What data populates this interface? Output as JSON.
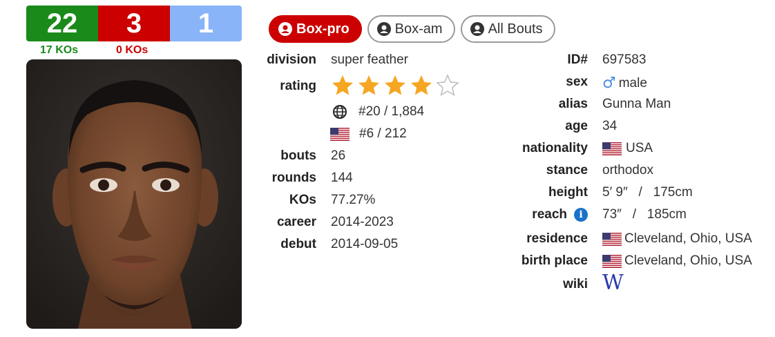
{
  "record": {
    "wins": "22",
    "losses": "3",
    "draws": "1",
    "win_kos": "17 KOs",
    "loss_kos": "0 KOs"
  },
  "colors": {
    "win": "#1a8a1a",
    "loss": "#cc0000",
    "draw": "#8ab4f8",
    "star": "#f5a623"
  },
  "tabs": [
    {
      "label": "Box-pro",
      "active": true,
      "icon": "user-circle-icon"
    },
    {
      "label": "Box-am",
      "active": false,
      "icon": "user-circle-icon"
    },
    {
      "label": "All Bouts",
      "active": false,
      "icon": "user-circle-icon"
    }
  ],
  "left": {
    "division_label": "division",
    "division": "super feather",
    "rating_label": "rating",
    "rating_stars": 4,
    "rating_max": 5,
    "world_rank": "#20 / 1,884",
    "us_rank": "#6 / 212",
    "bouts_label": "bouts",
    "bouts": "26",
    "rounds_label": "rounds",
    "rounds": "144",
    "kos_label": "KOs",
    "kos": "77.27%",
    "career_label": "career",
    "career": "2014-2023",
    "debut_label": "debut",
    "debut": "2014-09-05"
  },
  "right": {
    "id_label": "ID#",
    "id": "697583",
    "sex_label": "sex",
    "sex_symbol": "♂",
    "sex": "male",
    "alias_label": "alias",
    "alias": "Gunna Man",
    "age_label": "age",
    "age": "34",
    "nationality_label": "nationality",
    "nationality": "USA",
    "stance_label": "stance",
    "stance": "orthodox",
    "height_label": "height",
    "height": "5′ 9″   /   175cm",
    "reach_label": "reach",
    "reach": "73″   /   185cm",
    "residence_label": "residence",
    "residence": "Cleveland, Ohio, USA",
    "birth_label": "birth place",
    "birth_place": "Cleveland, Ohio, USA",
    "wiki_label": "wiki",
    "wiki_icon": "W"
  }
}
